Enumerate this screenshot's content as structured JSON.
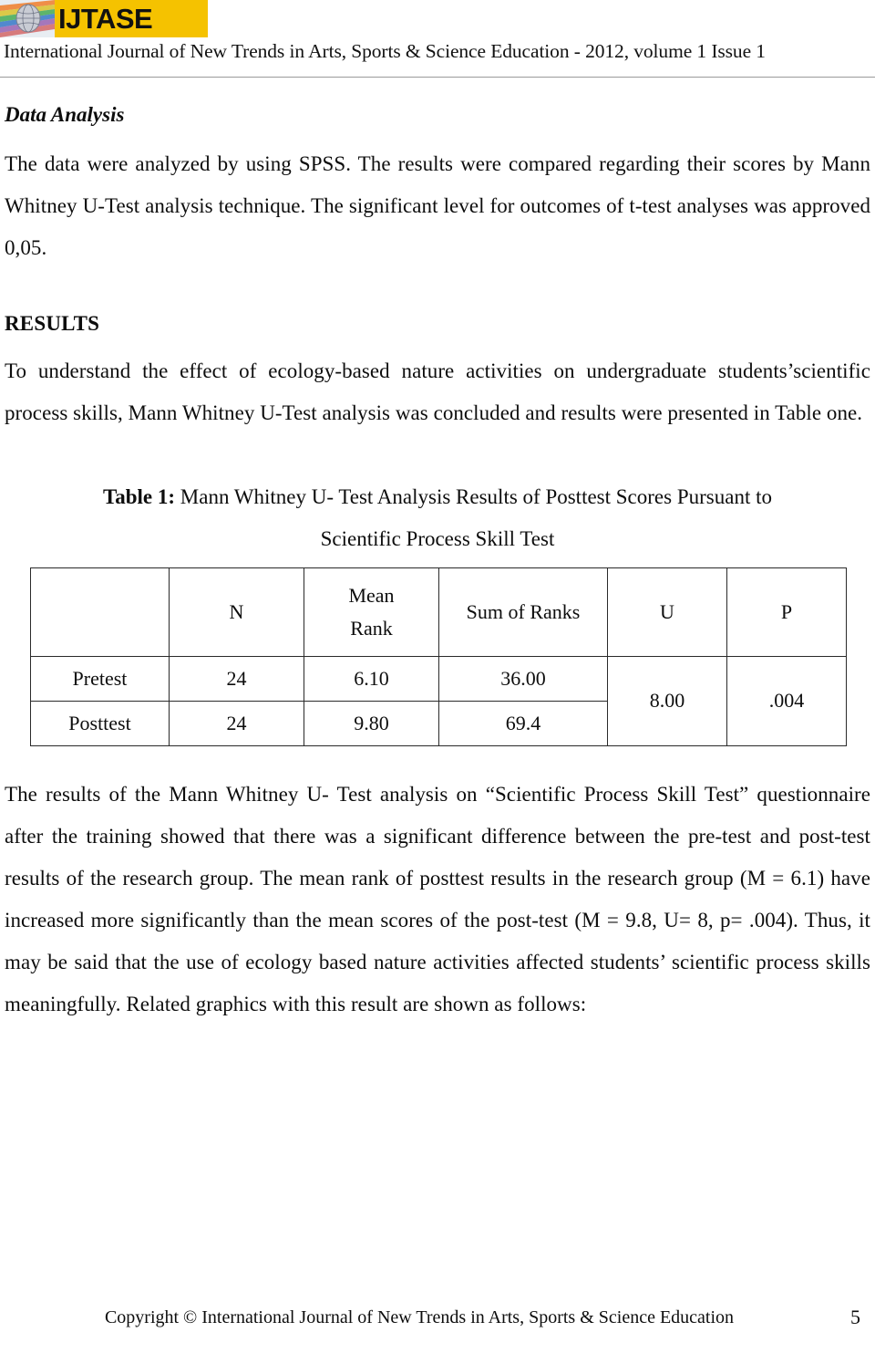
{
  "header": {
    "logo_text": "IJTASE",
    "logo_icon": "globe-network-logo",
    "journal_line": "International Journal of New Trends in Arts, Sports & Science Education - 2012, volume 1 Issue 1",
    "logo_bg_color": "#f5c200"
  },
  "sections": {
    "data_analysis": {
      "heading": "Data Analysis",
      "paragraph": "The data were analyzed by using SPSS. The results were compared regarding their scores by Mann Whitney U-Test analysis technique. The significant level for outcomes of t-test analyses was approved 0,05."
    },
    "results": {
      "heading": "RESULTS",
      "paragraph": "To understand the effect of ecology-based nature activities on undergraduate students’scientific process skills, Mann Whitney U-Test analysis was concluded and results were presented in Table one.",
      "discussion": "The results of the Mann Whitney U- Test analysis on “Scientific Process Skill Test” questionnaire after the training showed that there was a significant difference between the pre-test and post-test results of the research group. The mean rank of posttest results in the research group (M = 6.1) have increased more significantly than the mean scores of the post-test (M = 9.8, U= 8, p= .004). Thus, it may be said that the use of ecology based nature activities affected students’ scientific process skills meaningfully. Related graphics with this result are shown as follows:"
    }
  },
  "table": {
    "caption_label": "Table 1:",
    "caption_line1": " Mann Whitney U- Test Analysis Results of Posttest Scores Pursuant to",
    "caption_line2": "Scientific Process Skill Test",
    "headers": {
      "blank": "",
      "n": "N",
      "mean_rank_line1": "Mean",
      "mean_rank_line2": "Rank",
      "sum_of_ranks": "Sum of Ranks",
      "u": "U",
      "p": "P"
    },
    "rows": [
      {
        "label": "Pretest",
        "n": "24",
        "mean_rank": "6.10",
        "sum_of_ranks": "36.00"
      },
      {
        "label": "Posttest",
        "n": "24",
        "mean_rank": "9.80",
        "sum_of_ranks": "69.4"
      }
    ],
    "u_value": "8.00",
    "p_value": ".004"
  },
  "footer": {
    "copyright": "Copyright © International Journal of New Trends in Arts, Sports & Science Education",
    "page_number": "5"
  }
}
